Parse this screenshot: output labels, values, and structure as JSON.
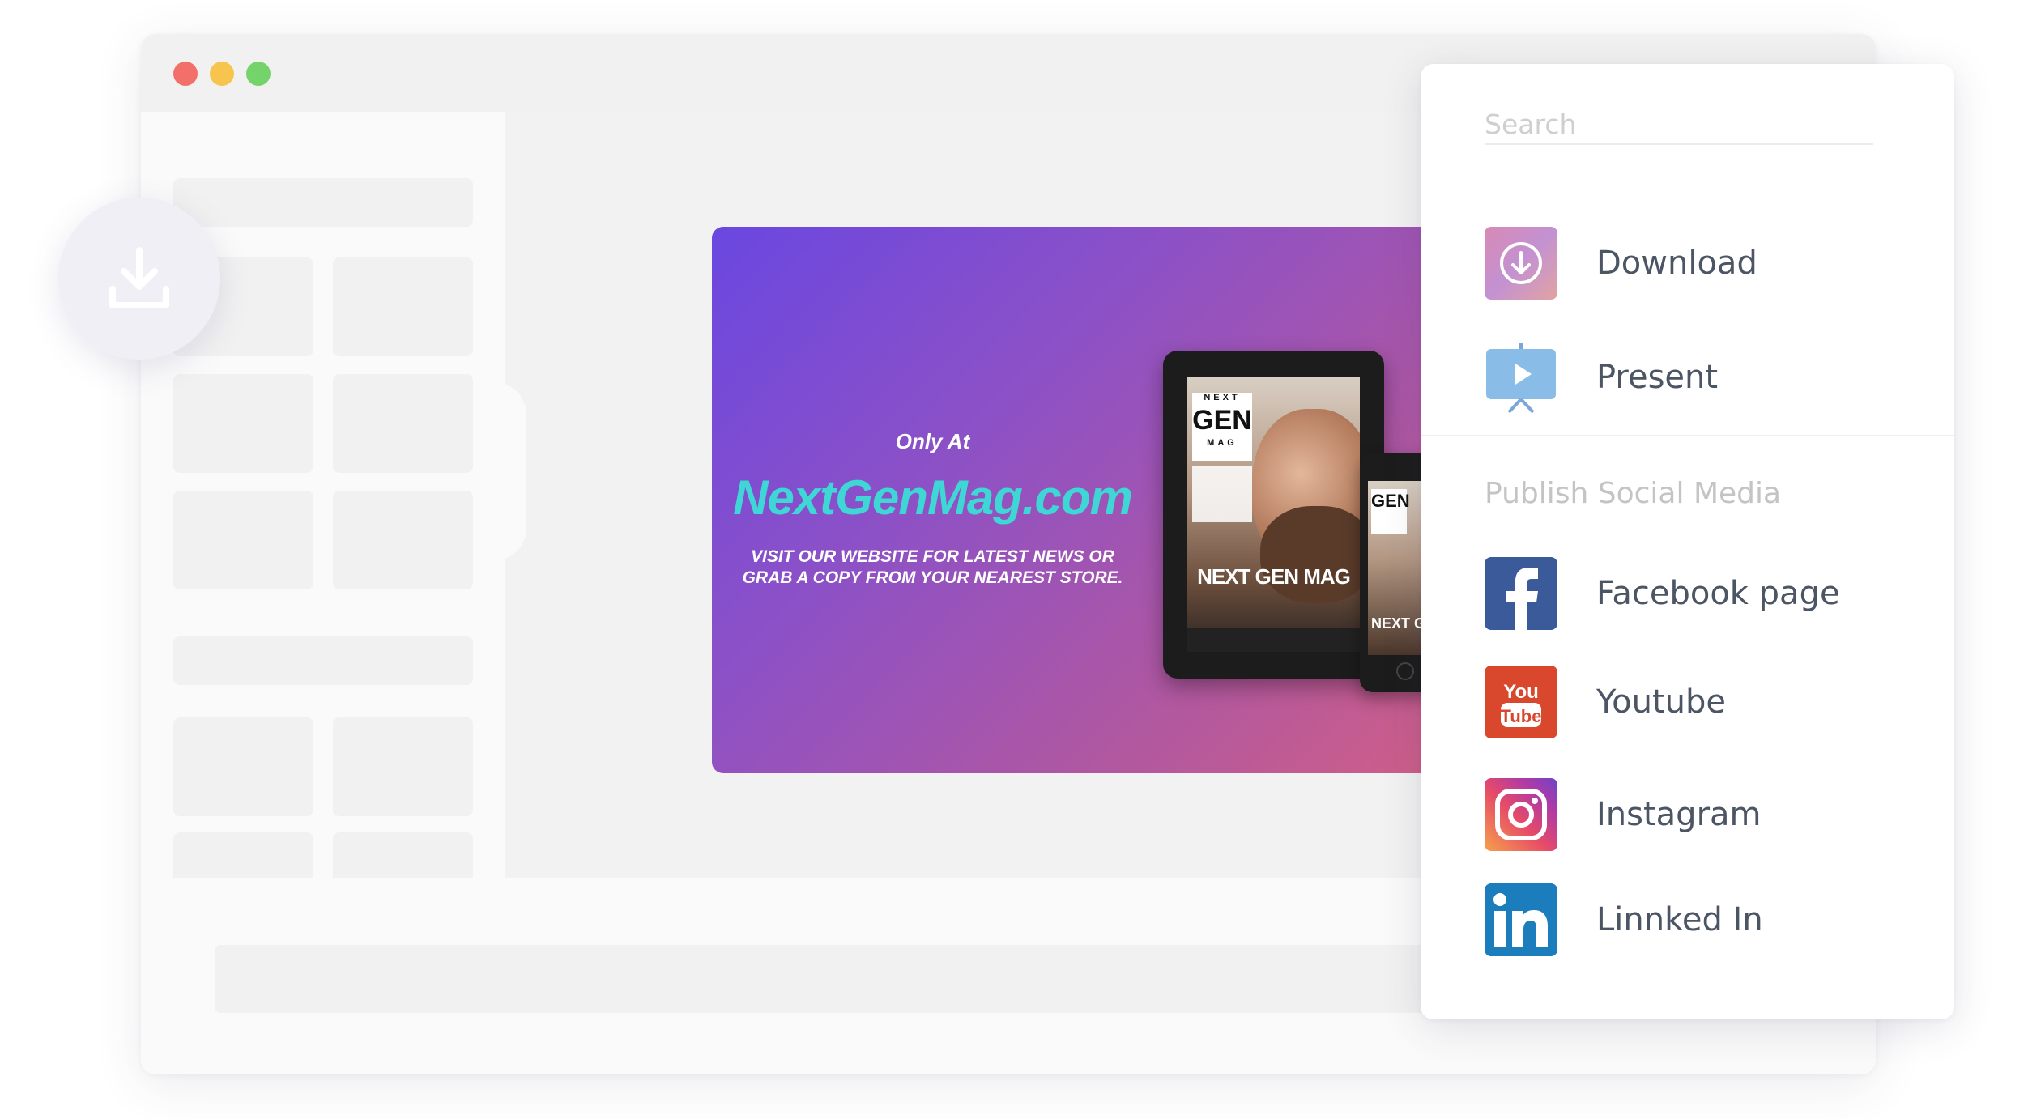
{
  "share_panel": {
    "search": {
      "placeholder": "Search",
      "value": ""
    },
    "actions": [
      {
        "label": "Download",
        "icon": "download-icon"
      },
      {
        "label": "Present",
        "icon": "present-icon"
      }
    ],
    "section_title": "Publish Social Media",
    "social": [
      {
        "label": "Facebook page",
        "icon": "facebook-icon",
        "color": "#3b5a9a"
      },
      {
        "label": "Youtube",
        "icon": "youtube-icon",
        "color": "#d9482d"
      },
      {
        "label": "Instagram",
        "icon": "instagram-icon",
        "color": "#e64b68"
      },
      {
        "label": "Linnked In",
        "icon": "linkedin-icon",
        "color": "#1c7dbd"
      }
    ]
  },
  "banner": {
    "tagline": "Only At",
    "site": "NextGenMag.com",
    "subtitle": "VISIT OUR WEBSITE FOR LATEST NEWS OR GRAB A COPY FROM YOUR NEAREST STORE.",
    "magazine_logo_main": "GEN",
    "magazine_logo_top": "NEXT",
    "magazine_logo_bottom": "MAG",
    "magazine_title": "NEXT GEN MAG",
    "phone_title": "NEXT GEN"
  },
  "colors": {
    "site_text": "#3fd6d6",
    "window_dot_red": "#f36f6a",
    "window_dot_yellow": "#f7c54e",
    "window_dot_green": "#74d36b"
  }
}
